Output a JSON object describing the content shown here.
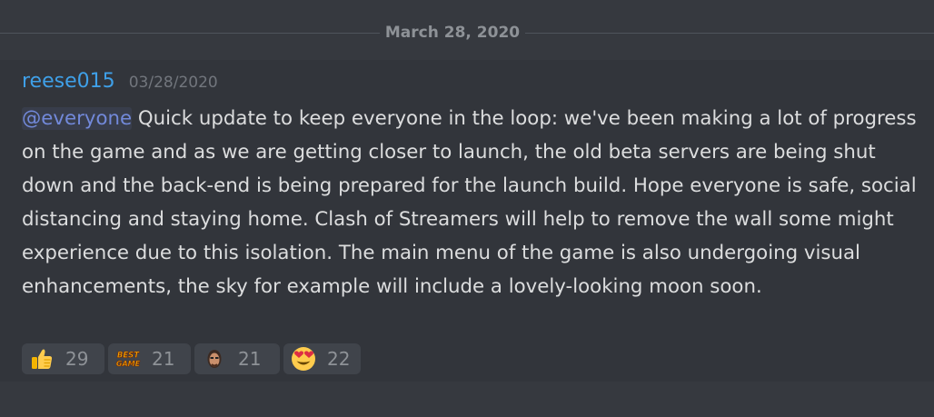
{
  "divider": {
    "date": "March 28, 2020"
  },
  "message": {
    "author": "reese015",
    "timestamp": "03/28/2020",
    "mention": "@everyone",
    "text": " Quick update to keep everyone in the loop: we've been making a lot of progress on the game and as we are getting closer to launch, the old beta servers are being shut down and the back-end is being prepared for the launch build. Hope everyone is safe, social distancing and staying home. Clash of Streamers will help to remove the wall some might experience due to this isolation. The main menu of the game is also undergoing visual enhancements, the sky for example will include a lovely-looking moon soon."
  },
  "reactions": [
    {
      "icon": "thumbs-up-icon",
      "count": "29"
    },
    {
      "icon": "best-game-emoji-icon",
      "badge_text": "BEST GAME",
      "count": "21"
    },
    {
      "icon": "streamer-face-emoji-icon",
      "count": "21"
    },
    {
      "icon": "heart-eyes-emoji-icon",
      "count": "22"
    }
  ],
  "colors": {
    "background": "#36393f",
    "message_highlight": "#32353b",
    "username": "#3fa0e8",
    "mention": "#7289da",
    "text": "#dcddde",
    "reaction_bg": "#40444b"
  }
}
